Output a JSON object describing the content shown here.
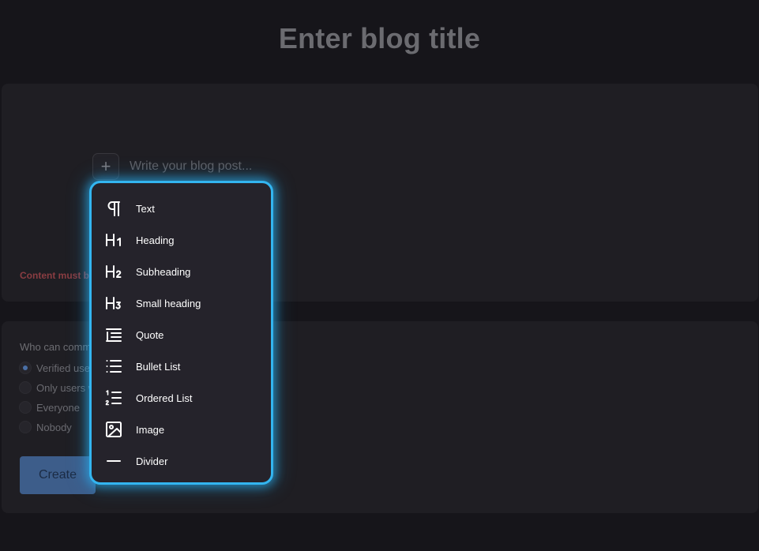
{
  "header": {
    "title_placeholder": "Enter blog title"
  },
  "editor": {
    "add_block_symbol": "+",
    "body_placeholder": "Write your blog post...",
    "error": "Content must be"
  },
  "settings": {
    "comment_label": "Who can comme",
    "options": [
      {
        "label": "Verified user",
        "checked": true
      },
      {
        "label": "Only users w",
        "checked": false
      },
      {
        "label": "Everyone",
        "checked": false
      },
      {
        "label": "Nobody",
        "checked": false
      }
    ],
    "create_label": "Create"
  },
  "block_menu": {
    "items": [
      {
        "label": "Text",
        "icon": "paragraph-icon"
      },
      {
        "label": "Heading",
        "icon": "heading-1-icon"
      },
      {
        "label": "Subheading",
        "icon": "heading-2-icon"
      },
      {
        "label": "Small heading",
        "icon": "heading-3-icon"
      },
      {
        "label": "Quote",
        "icon": "quote-icon"
      },
      {
        "label": "Bullet List",
        "icon": "bullet-list-icon"
      },
      {
        "label": "Ordered List",
        "icon": "ordered-list-icon"
      },
      {
        "label": "Image",
        "icon": "image-icon"
      },
      {
        "label": "Divider",
        "icon": "divider-icon"
      }
    ]
  },
  "colors": {
    "background": "#16151a",
    "panel": "#1f1e23",
    "menu_border": "#33b5f0",
    "menu_background": "#25232b",
    "error": "#8a3d42",
    "primary_button": "#3d5d8a"
  }
}
